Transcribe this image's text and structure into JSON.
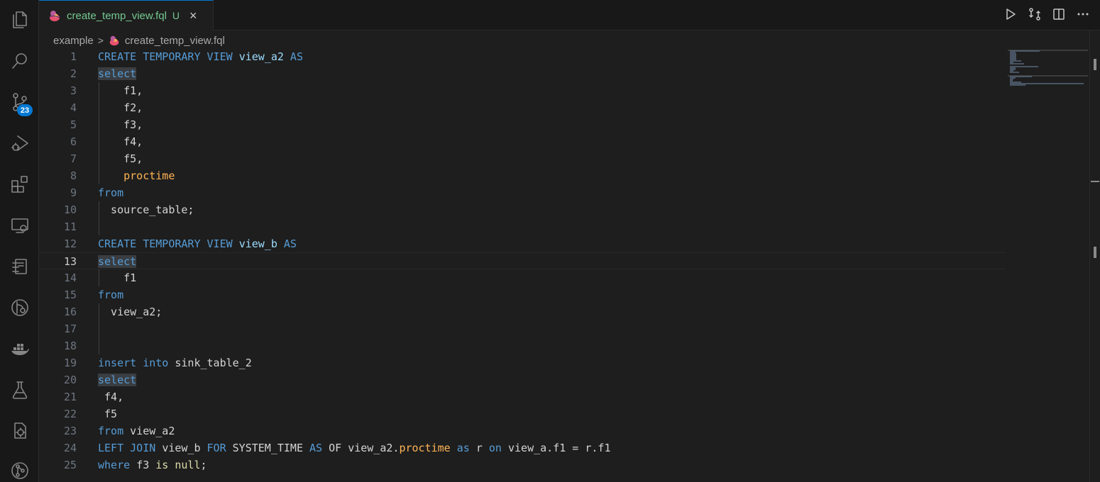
{
  "activity_bar": {
    "items": [
      {
        "icon": "files-icon"
      },
      {
        "icon": "search-icon"
      },
      {
        "icon": "source-control-icon",
        "badge": "23"
      },
      {
        "icon": "run-debug-icon"
      },
      {
        "icon": "extensions-icon"
      },
      {
        "icon": "remote-explorer-icon"
      },
      {
        "icon": "timeline-icon"
      },
      {
        "icon": "gitlens-icon"
      },
      {
        "icon": "docker-icon"
      },
      {
        "icon": "testing-icon"
      },
      {
        "icon": "settings-sync-icon"
      },
      {
        "icon": "git-graph-icon"
      }
    ]
  },
  "tab": {
    "label": "create_temp_view.fql",
    "status": "U",
    "close": "×"
  },
  "breadcrumb": {
    "folder": "example",
    "separator": ">",
    "file": "create_temp_view.fql"
  },
  "editor": {
    "current_line": 13,
    "lines": [
      {
        "n": "1",
        "tokens": [
          [
            "kw",
            "CREATE TEMPORARY VIEW "
          ],
          [
            "id",
            "view_a2"
          ],
          [
            "kw",
            " AS"
          ]
        ]
      },
      {
        "n": "2",
        "tokens": [
          [
            "kw sel",
            "select"
          ]
        ]
      },
      {
        "n": "3",
        "guide": true,
        "tokens": [
          [
            "",
            "    f1,"
          ]
        ]
      },
      {
        "n": "4",
        "guide": true,
        "tokens": [
          [
            "",
            "    f2,"
          ]
        ]
      },
      {
        "n": "5",
        "guide": true,
        "tokens": [
          [
            "",
            "    f3,"
          ]
        ]
      },
      {
        "n": "6",
        "guide": true,
        "tokens": [
          [
            "",
            "    f4,"
          ]
        ]
      },
      {
        "n": "7",
        "guide": true,
        "tokens": [
          [
            "",
            "    f5,"
          ]
        ]
      },
      {
        "n": "8",
        "guide": true,
        "tokens": [
          [
            "",
            "    "
          ],
          [
            "fn",
            "proctime"
          ]
        ]
      },
      {
        "n": "9",
        "tokens": [
          [
            "kw",
            "from"
          ]
        ]
      },
      {
        "n": "10",
        "guide": true,
        "tokens": [
          [
            "",
            "  source_table;"
          ]
        ]
      },
      {
        "n": "11",
        "guide": true,
        "tokens": [
          [
            "",
            ""
          ]
        ]
      },
      {
        "n": "12",
        "tokens": [
          [
            "kw",
            "CREATE TEMPORARY VIEW "
          ],
          [
            "id",
            "view_b"
          ],
          [
            "kw",
            " AS"
          ]
        ]
      },
      {
        "n": "13",
        "tokens": [
          [
            "kw sel",
            "select"
          ]
        ]
      },
      {
        "n": "14",
        "guide": true,
        "tokens": [
          [
            "",
            "    f1"
          ]
        ]
      },
      {
        "n": "15",
        "tokens": [
          [
            "kw",
            "from"
          ]
        ]
      },
      {
        "n": "16",
        "guide": true,
        "tokens": [
          [
            "",
            "  view_a2;"
          ]
        ]
      },
      {
        "n": "17",
        "guide": true,
        "tokens": [
          [
            "",
            ""
          ]
        ]
      },
      {
        "n": "18",
        "guide": true,
        "tokens": [
          [
            "",
            ""
          ]
        ]
      },
      {
        "n": "19",
        "tokens": [
          [
            "kw",
            "insert into "
          ],
          [
            "",
            "sink_table_2"
          ]
        ]
      },
      {
        "n": "20",
        "tokens": [
          [
            "kw sel",
            "select"
          ]
        ]
      },
      {
        "n": "21",
        "tokens": [
          [
            "",
            ""
          ],
          [
            "",
            " f4,"
          ]
        ]
      },
      {
        "n": "22",
        "tokens": [
          [
            "",
            ""
          ],
          [
            "",
            " f5"
          ]
        ]
      },
      {
        "n": "23",
        "tokens": [
          [
            "kw",
            "from "
          ],
          [
            "",
            "view_a2"
          ]
        ]
      },
      {
        "n": "24",
        "tokens": [
          [
            "kw",
            "LEFT JOIN "
          ],
          [
            "",
            "view_b "
          ],
          [
            "kw",
            "FOR "
          ],
          [
            "",
            "SYSTEM_TIME "
          ],
          [
            "kw",
            "AS "
          ],
          [
            "",
            "OF view_a2."
          ],
          [
            "fn",
            "proctime"
          ],
          [
            "kw",
            " as "
          ],
          [
            "",
            "r "
          ],
          [
            "kw",
            "on "
          ],
          [
            "",
            "view_a.f1 = r.f1"
          ]
        ]
      },
      {
        "n": "25",
        "tokens": [
          [
            "kw",
            "where "
          ],
          [
            "",
            "f3 "
          ],
          [
            "nl",
            "is null"
          ],
          [
            "",
            ";"
          ]
        ]
      }
    ]
  },
  "colors": {
    "accent": "#0078d4",
    "untracked": "#73c991",
    "keyword": "#569cd6",
    "identifier": "#9cdcfe",
    "function": "#ffb454",
    "null_literal": "#dcdcaa"
  }
}
